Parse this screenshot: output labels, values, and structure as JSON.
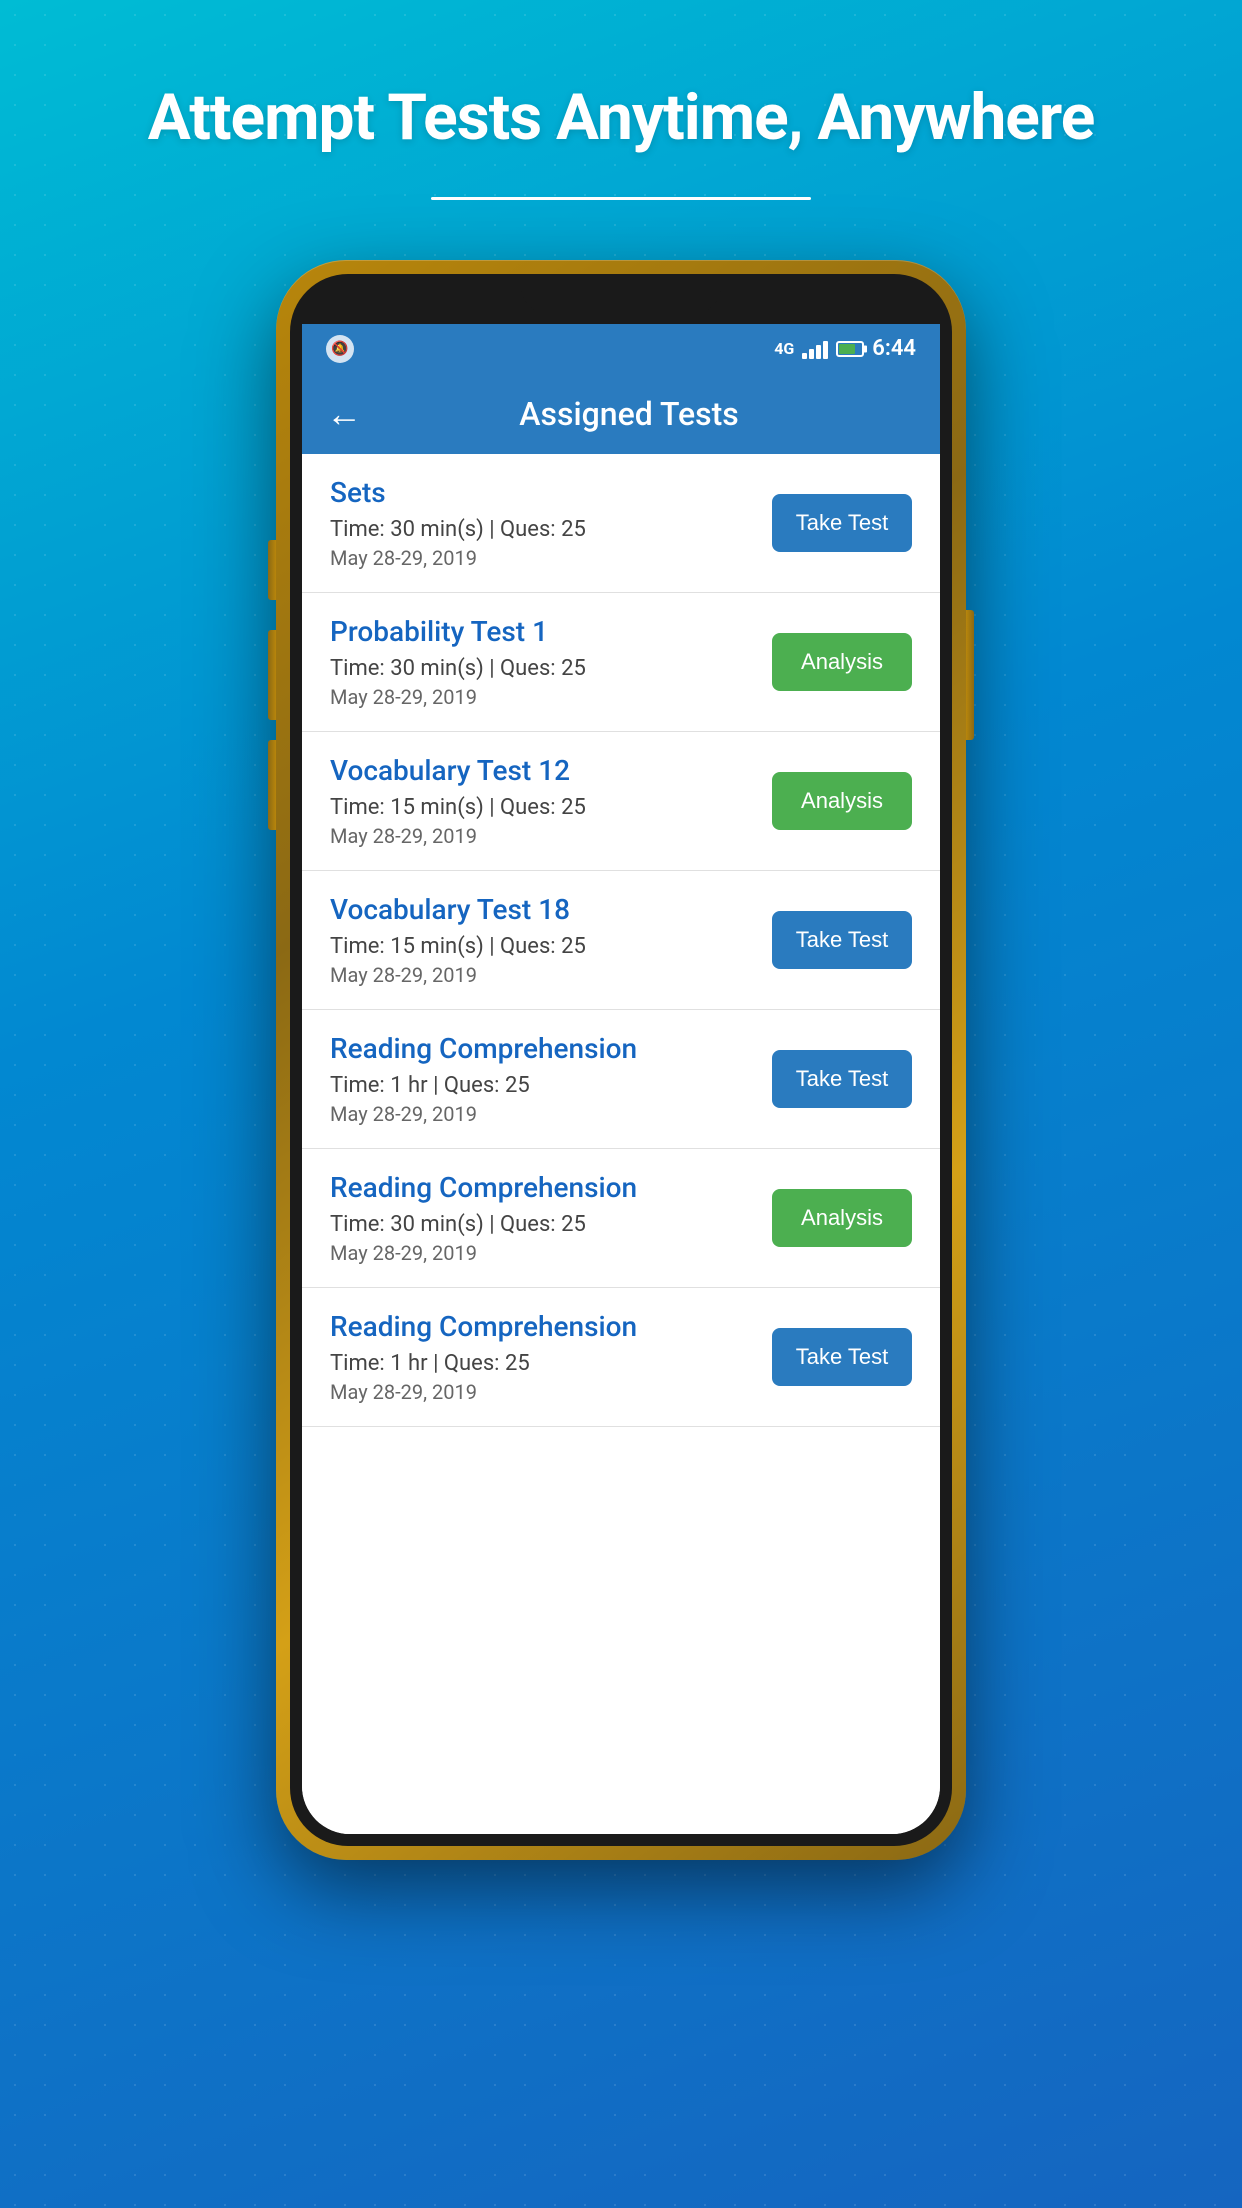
{
  "hero": {
    "title": "Attempt Tests Anytime, Anywhere"
  },
  "app_bar": {
    "title": "Assigned Tests",
    "back_label": "←"
  },
  "status_bar": {
    "network": "4G",
    "time": "6:44"
  },
  "tests": [
    {
      "id": 1,
      "name": "Sets",
      "time": "Time: 30 min(s) | Ques: 25",
      "date": "May 28-29, 2019",
      "action": "Take Test",
      "action_type": "take"
    },
    {
      "id": 2,
      "name": "Probability Test 1",
      "time": "Time: 30 min(s) | Ques: 25",
      "date": "May 28-29, 2019",
      "action": "Analysis",
      "action_type": "analysis"
    },
    {
      "id": 3,
      "name": "Vocabulary Test 12",
      "time": "Time: 15 min(s) | Ques: 25",
      "date": "May 28-29, 2019",
      "action": "Analysis",
      "action_type": "analysis"
    },
    {
      "id": 4,
      "name": "Vocabulary Test 18",
      "time": "Time: 15 min(s) | Ques: 25",
      "date": "May 28-29, 2019",
      "action": "Take Test",
      "action_type": "take"
    },
    {
      "id": 5,
      "name": "Reading Comprehension",
      "time": "Time: 1 hr | Ques: 25",
      "date": "May 28-29, 2019",
      "action": "Take Test",
      "action_type": "take"
    },
    {
      "id": 6,
      "name": "Reading Comprehension",
      "time": "Time: 30 min(s) | Ques: 25",
      "date": "May 28-29, 2019",
      "action": "Analysis",
      "action_type": "analysis"
    },
    {
      "id": 7,
      "name": "Reading Comprehension",
      "time": "Time: 1 hr | Ques: 25",
      "date": "May 28-29, 2019",
      "action": "Take Test",
      "action_type": "take"
    }
  ]
}
